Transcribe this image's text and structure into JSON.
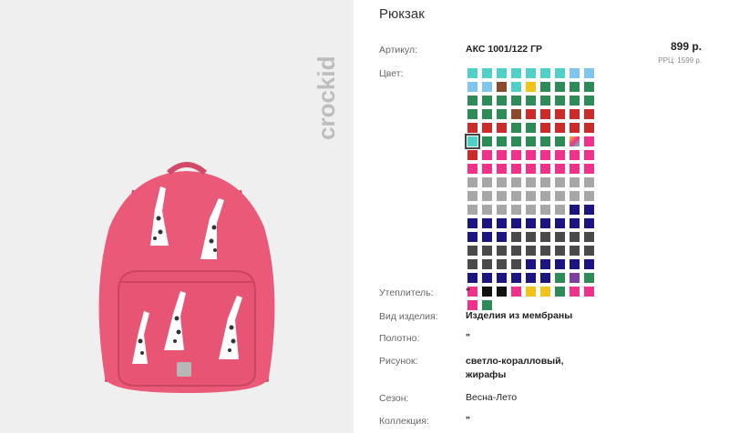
{
  "brand": {
    "logo_text": "crockid"
  },
  "product": {
    "title": "Рюкзак",
    "price": "899 р.",
    "rrp": "РРЦ: 1599 р."
  },
  "fields": {
    "article_label": "Артикул:",
    "article_value": "АКС 1001/122 ГР",
    "color_label": "Цвет:",
    "insulation_label": "Утеплитель:",
    "insulation_value": "\"",
    "kind_label": "Вид изделия:",
    "kind_value": "Изделия из мембраны",
    "fabric_label": "Полотно:",
    "fabric_value": "\"",
    "pattern_label": "Рисунок:",
    "pattern_value_line1": "светло-коралловый,",
    "pattern_value_line2": "жирафы",
    "season_label": "Сезон:",
    "season_value": "Весна-Лето",
    "collection_label": "Коллекция:",
    "collection_value": "\""
  },
  "colors": {
    "teal": "#4fd1c5",
    "lightblue": "#7ec6f0",
    "brown": "#8b4a2b",
    "yellow": "#f2c318",
    "green": "#2e8b57",
    "red": "#cc2b2b",
    "pink": "#f0338a",
    "gray": "#a7a7a7",
    "navy": "#1a1580",
    "darkgray": "#4a4a4a",
    "purple": "#7b3fa0",
    "black": "#111111",
    "rainbow": "linear-gradient(135deg,#f2c318,#f0338a,#4fd1c5)",
    "backpack": "#ea5a78"
  },
  "swatch_rows": [
    [
      "teal",
      "teal",
      "teal",
      "teal",
      "teal",
      "teal",
      "teal",
      "lightblue",
      "lightblue",
      "lightblue"
    ],
    [
      "lightblue",
      "brown",
      "teal",
      "yellow",
      "green",
      "green",
      "green",
      "green",
      "green",
      "green"
    ],
    [
      "green",
      "green",
      "green",
      "green",
      "green",
      "green",
      "green",
      "green",
      "green",
      "green"
    ],
    [
      "brown",
      "red",
      "red",
      "red",
      "red",
      "red",
      "red",
      "red",
      "red",
      "green"
    ],
    [
      "green",
      "red",
      "red",
      "red",
      "red",
      "teal",
      "green",
      "green",
      "green",
      "green"
    ],
    [
      "green",
      "green",
      "rainbow",
      "pink",
      "red",
      "pink",
      "pink",
      "pink",
      "pink",
      "pink"
    ],
    [
      "pink",
      "pink",
      "pink",
      "pink",
      "pink",
      "pink",
      "pink",
      "pink",
      "pink",
      "pink"
    ],
    [
      "pink",
      "pink",
      "gray",
      "gray",
      "gray",
      "gray",
      "gray",
      "gray",
      "gray",
      "gray"
    ],
    [
      "gray",
      "gray",
      "gray",
      "gray",
      "gray",
      "gray",
      "gray",
      "gray",
      "gray",
      "gray"
    ],
    [
      "gray",
      "gray",
      "gray",
      "gray",
      "gray",
      "gray",
      "gray",
      "navy",
      "navy",
      "navy"
    ],
    [
      "navy",
      "navy",
      "navy",
      "navy",
      "navy",
      "navy",
      "navy",
      "navy",
      "navy",
      "navy"
    ],
    [
      "navy",
      "darkgray",
      "darkgray",
      "darkgray",
      "darkgray",
      "darkgray",
      "darkgray",
      "darkgray",
      "darkgray",
      "darkgray"
    ],
    [
      "darkgray",
      "darkgray",
      "darkgray",
      "darkgray",
      "darkgray",
      "darkgray",
      "darkgray",
      "darkgray",
      "darkgray",
      "darkgray"
    ],
    [
      "navy",
      "navy",
      "navy",
      "navy",
      "navy",
      "navy",
      "navy",
      "navy",
      "navy",
      "navy"
    ],
    [
      "navy",
      "green",
      "purple",
      "green",
      "pink",
      "black",
      "black",
      "pink",
      "yellow",
      "yellow"
    ],
    [
      "green",
      "pink",
      "pink",
      "pink",
      "green"
    ]
  ],
  "selected_swatch": {
    "row": 4,
    "col": 5
  }
}
